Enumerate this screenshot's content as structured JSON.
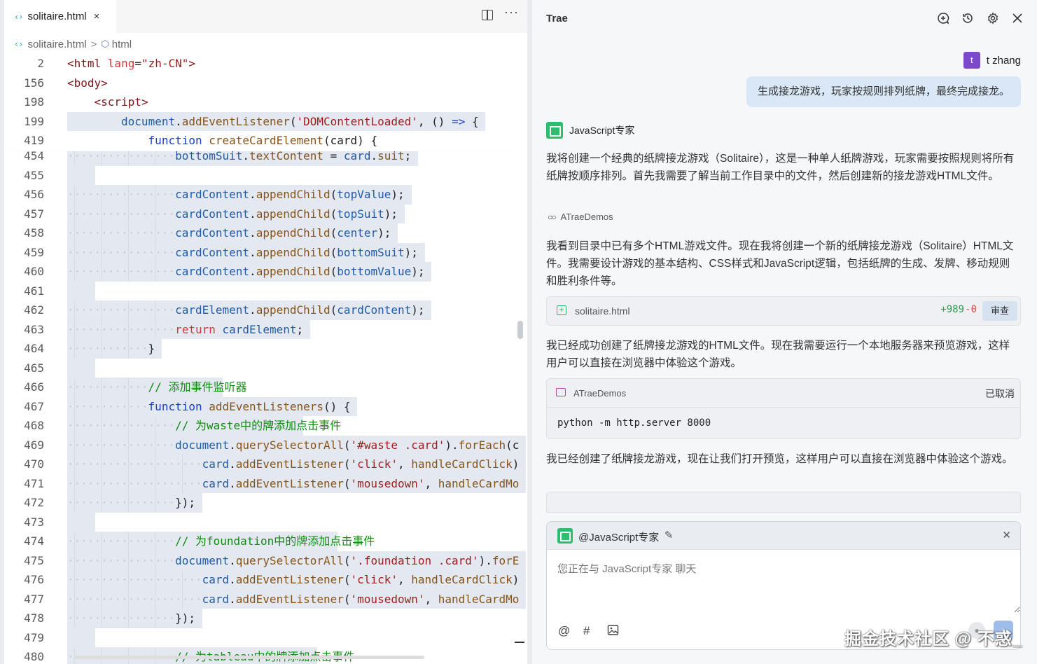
{
  "editor": {
    "tab": {
      "label": "solitaire.html",
      "close": "×"
    },
    "breadcrumb": {
      "file": "solitaire.html",
      "separator": ">",
      "node": "html"
    },
    "sticky_lines": [
      {
        "n": "2",
        "indent": 0,
        "sel": false,
        "parts": [
          [
            "tg",
            "<html "
          ],
          [
            "at",
            "lang"
          ],
          [
            "pl",
            "="
          ],
          [
            "st",
            "\"zh-CN\""
          ],
          [
            "tg",
            ">"
          ]
        ]
      },
      {
        "n": "156",
        "indent": 0,
        "sel": false,
        "parts": [
          [
            "tg",
            "<body>"
          ]
        ]
      },
      {
        "n": "198",
        "indent": 1,
        "sel": false,
        "parts": [
          [
            "tg",
            "<script>"
          ]
        ]
      },
      {
        "n": "199",
        "indent": 2,
        "sel": true,
        "parts": [
          [
            "va",
            "document"
          ],
          [
            "pl",
            "."
          ],
          [
            "fn",
            "addEventListener"
          ],
          [
            "pl",
            "("
          ],
          [
            "st",
            "'DOMContentLoaded'"
          ],
          [
            "pl",
            ", () "
          ],
          [
            "kw",
            "=>"
          ],
          [
            "pl",
            " {"
          ]
        ]
      },
      {
        "n": "419",
        "indent": 3,
        "sel": false,
        "parts": [
          [
            "kw",
            "function"
          ],
          [
            "pl",
            " "
          ],
          [
            "fn",
            "createCardElement"
          ],
          [
            "pl",
            "(card) {"
          ]
        ]
      }
    ],
    "lines": [
      {
        "n": "454",
        "indent": 4,
        "parts": [
          [
            "va",
            "bottomSuit"
          ],
          [
            "pl",
            "."
          ],
          [
            "fn",
            "textContent"
          ],
          [
            "pl",
            " = "
          ],
          [
            "va",
            "card"
          ],
          [
            "pl",
            "."
          ],
          [
            "fn",
            "suit"
          ],
          [
            "pl",
            ";"
          ]
        ]
      },
      {
        "n": "455",
        "indent": 0,
        "parts": []
      },
      {
        "n": "456",
        "indent": 4,
        "parts": [
          [
            "va",
            "cardContent"
          ],
          [
            "pl",
            "."
          ],
          [
            "fn",
            "appendChild"
          ],
          [
            "pl",
            "("
          ],
          [
            "va",
            "topValue"
          ],
          [
            "pl",
            ");"
          ]
        ]
      },
      {
        "n": "457",
        "indent": 4,
        "parts": [
          [
            "va",
            "cardContent"
          ],
          [
            "pl",
            "."
          ],
          [
            "fn",
            "appendChild"
          ],
          [
            "pl",
            "("
          ],
          [
            "va",
            "topSuit"
          ],
          [
            "pl",
            ");"
          ]
        ]
      },
      {
        "n": "458",
        "indent": 4,
        "parts": [
          [
            "va",
            "cardContent"
          ],
          [
            "pl",
            "."
          ],
          [
            "fn",
            "appendChild"
          ],
          [
            "pl",
            "("
          ],
          [
            "va",
            "center"
          ],
          [
            "pl",
            ");"
          ]
        ]
      },
      {
        "n": "459",
        "indent": 4,
        "parts": [
          [
            "va",
            "cardContent"
          ],
          [
            "pl",
            "."
          ],
          [
            "fn",
            "appendChild"
          ],
          [
            "pl",
            "("
          ],
          [
            "va",
            "bottomSuit"
          ],
          [
            "pl",
            ");"
          ]
        ]
      },
      {
        "n": "460",
        "indent": 4,
        "parts": [
          [
            "va",
            "cardContent"
          ],
          [
            "pl",
            "."
          ],
          [
            "fn",
            "appendChild"
          ],
          [
            "pl",
            "("
          ],
          [
            "va",
            "bottomValue"
          ],
          [
            "pl",
            ");"
          ]
        ]
      },
      {
        "n": "461",
        "indent": 0,
        "parts": []
      },
      {
        "n": "462",
        "indent": 4,
        "parts": [
          [
            "va",
            "cardElement"
          ],
          [
            "pl",
            "."
          ],
          [
            "fn",
            "appendChild"
          ],
          [
            "pl",
            "("
          ],
          [
            "va",
            "cardContent"
          ],
          [
            "pl",
            ");"
          ]
        ]
      },
      {
        "n": "463",
        "indent": 4,
        "parts": [
          [
            "at",
            "return"
          ],
          [
            "pl",
            " "
          ],
          [
            "va",
            "cardElement"
          ],
          [
            "pl",
            ";"
          ]
        ]
      },
      {
        "n": "464",
        "indent": 3,
        "parts": [
          [
            "pl",
            "}"
          ]
        ]
      },
      {
        "n": "465",
        "indent": 0,
        "parts": []
      },
      {
        "n": "466",
        "indent": 3,
        "parts": [
          [
            "cm",
            "// 添加事件监听器"
          ]
        ]
      },
      {
        "n": "467",
        "indent": 3,
        "parts": [
          [
            "kw",
            "function"
          ],
          [
            "pl",
            " "
          ],
          [
            "fn",
            "addEventListeners"
          ],
          [
            "pl",
            "() {"
          ]
        ]
      },
      {
        "n": "468",
        "indent": 4,
        "parts": [
          [
            "cm",
            "// 为waste中的牌添加点击事件"
          ]
        ]
      },
      {
        "n": "469",
        "indent": 4,
        "parts": [
          [
            "va",
            "document"
          ],
          [
            "pl",
            "."
          ],
          [
            "fn",
            "querySelectorAll"
          ],
          [
            "pl",
            "("
          ],
          [
            "st",
            "'#waste .card'"
          ],
          [
            "pl",
            ")."
          ],
          [
            "fn",
            "forEach"
          ],
          [
            "pl",
            "(c"
          ]
        ]
      },
      {
        "n": "470",
        "indent": 5,
        "parts": [
          [
            "va",
            "card"
          ],
          [
            "pl",
            "."
          ],
          [
            "fn",
            "addEventListener"
          ],
          [
            "pl",
            "("
          ],
          [
            "st",
            "'click'"
          ],
          [
            "pl",
            ", "
          ],
          [
            "fn",
            "handleCardClick"
          ],
          [
            "pl",
            ")"
          ]
        ]
      },
      {
        "n": "471",
        "indent": 5,
        "parts": [
          [
            "va",
            "card"
          ],
          [
            "pl",
            "."
          ],
          [
            "fn",
            "addEventListener"
          ],
          [
            "pl",
            "("
          ],
          [
            "st",
            "'mousedown'"
          ],
          [
            "pl",
            ", "
          ],
          [
            "fn",
            "handleCardMo"
          ]
        ]
      },
      {
        "n": "472",
        "indent": 4,
        "parts": [
          [
            "pl",
            "});"
          ]
        ]
      },
      {
        "n": "473",
        "indent": 0,
        "parts": []
      },
      {
        "n": "474",
        "indent": 4,
        "parts": [
          [
            "cm",
            "// 为foundation中的牌添加点击事件"
          ]
        ]
      },
      {
        "n": "475",
        "indent": 4,
        "parts": [
          [
            "va",
            "document"
          ],
          [
            "pl",
            "."
          ],
          [
            "fn",
            "querySelectorAll"
          ],
          [
            "pl",
            "("
          ],
          [
            "st",
            "'.foundation .card'"
          ],
          [
            "pl",
            ")."
          ],
          [
            "fn",
            "forE"
          ]
        ]
      },
      {
        "n": "476",
        "indent": 5,
        "parts": [
          [
            "va",
            "card"
          ],
          [
            "pl",
            "."
          ],
          [
            "fn",
            "addEventListener"
          ],
          [
            "pl",
            "("
          ],
          [
            "st",
            "'click'"
          ],
          [
            "pl",
            ", "
          ],
          [
            "fn",
            "handleCardClick"
          ],
          [
            "pl",
            ")"
          ]
        ]
      },
      {
        "n": "477",
        "indent": 5,
        "parts": [
          [
            "va",
            "card"
          ],
          [
            "pl",
            "."
          ],
          [
            "fn",
            "addEventListener"
          ],
          [
            "pl",
            "("
          ],
          [
            "st",
            "'mousedown'"
          ],
          [
            "pl",
            ", "
          ],
          [
            "fn",
            "handleCardMo"
          ]
        ]
      },
      {
        "n": "478",
        "indent": 4,
        "parts": [
          [
            "pl",
            "});"
          ]
        ]
      },
      {
        "n": "479",
        "indent": 0,
        "parts": []
      },
      {
        "n": "480",
        "indent": 4,
        "parts": [
          [
            "cm",
            "// 为tableau中的牌添加点击事件"
          ]
        ]
      }
    ]
  },
  "chat": {
    "title": "Trae",
    "user": {
      "avatar": "t",
      "name": "t zhang",
      "message": "生成接龙游戏，玩家按规则排列纸牌，最终完成接龙。"
    },
    "agent": {
      "name": "JavaScript专家"
    },
    "para1": "我将创建一个经典的纸牌接龙游戏（Solitaire），这是一种单人纸牌游戏，玩家需要按照规则将所有纸牌按顺序排列。首先我需要了解当前工作目录中的文件，然后创建新的接龙游戏HTML文件。",
    "workspace": "ATraeDemos",
    "para2": "我看到目录中已有多个HTML游戏文件。现在我将创建一个新的纸牌接龙游戏（Solitaire）HTML文件。我需要设计游戏的基本结构、CSS样式和JavaScript逻辑，包括纸牌的生成、发牌、移动规则和胜利条件等。",
    "file_card": {
      "name": "solitaire.html",
      "added": "+989",
      "removed": "-0",
      "review": "审查"
    },
    "para3": "我已经成功创建了纸牌接龙游戏的HTML文件。现在我需要运行一个本地服务器来预览游戏，这样用户可以直接在浏览器中体验这个游戏。",
    "terminal": {
      "workspace": "ATraeDemos",
      "status": "已取消",
      "command": "python -m http.server 8000"
    },
    "para4": "我已经创建了纸牌接龙游戏，现在让我们打开预览，这样用户可以直接在浏览器中体验这个游戏。",
    "input": {
      "mention": "@JavaScript专家",
      "placeholder": "您正在与 JavaScript专家 聊天"
    },
    "watermark": "掘金技术社区 @ 不惑_"
  }
}
